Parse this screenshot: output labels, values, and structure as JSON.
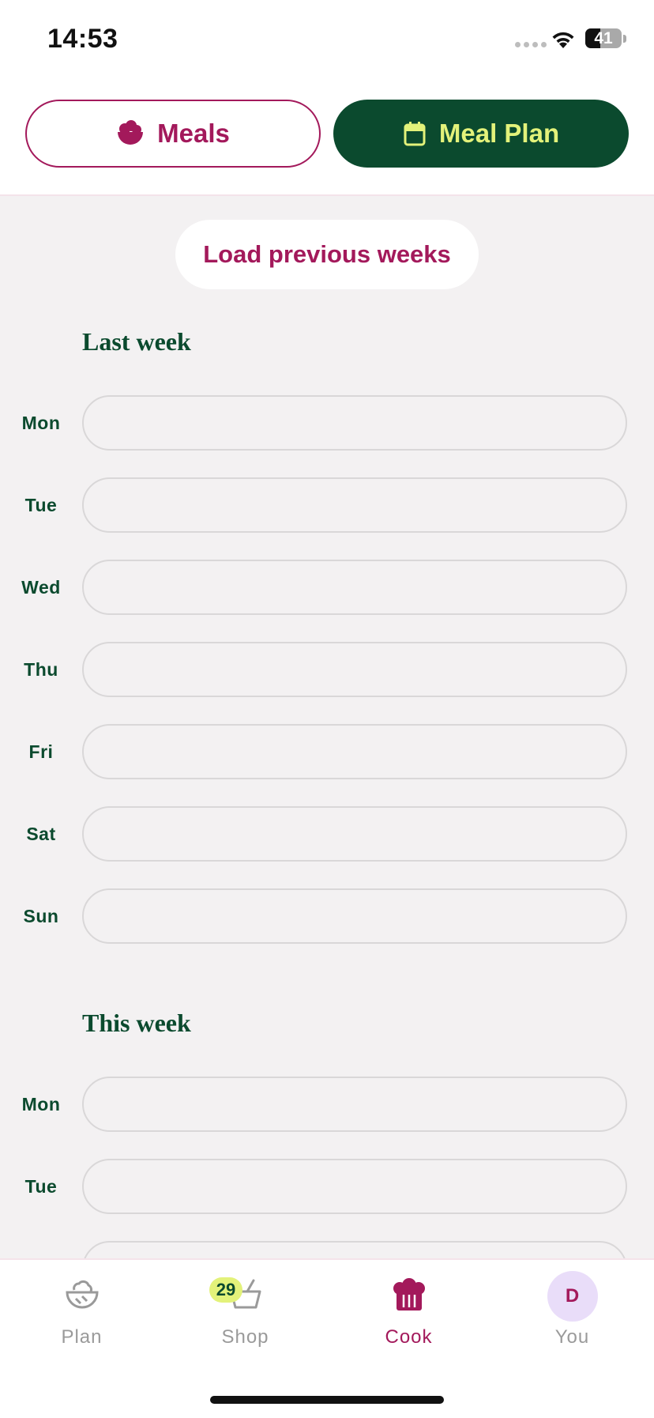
{
  "status_bar": {
    "time": "14:53",
    "battery": "41",
    "battery_level": 0.41
  },
  "header": {
    "meals_label": "Meals",
    "meal_plan_label": "Meal Plan",
    "meals_icon": "salad-bowl-icon",
    "meal_plan_icon": "calendar-icon"
  },
  "main": {
    "load_previous_label": "Load previous weeks",
    "weeks": [
      {
        "title": "Last week",
        "days": [
          "Mon",
          "Tue",
          "Wed",
          "Thu",
          "Fri",
          "Sat",
          "Sun"
        ]
      },
      {
        "title": "This week",
        "days": [
          "Mon",
          "Tue"
        ]
      }
    ]
  },
  "tab_bar": {
    "tabs": [
      {
        "label": "Plan",
        "icon": "salad-bowl-icon"
      },
      {
        "label": "Shop",
        "icon": "basket-icon",
        "badge": "29"
      },
      {
        "label": "Cook",
        "icon": "chef-hat-icon",
        "active": true
      },
      {
        "label": "You",
        "icon": "avatar",
        "avatar_initial": "D"
      }
    ]
  },
  "colors": {
    "brand_magenta": "#A3195B",
    "brand_green": "#0B4A2E",
    "accent_lime": "#E3F27A",
    "background": "#F3F1F2"
  }
}
